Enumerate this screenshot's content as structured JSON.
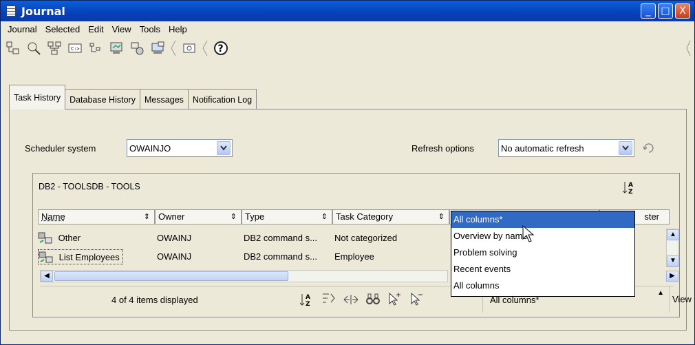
{
  "window": {
    "title": "Journal",
    "controls": [
      "_",
      "□",
      "X"
    ]
  },
  "menu": [
    "Journal",
    "Selected",
    "Edit",
    "View",
    "Tools",
    "Help"
  ],
  "toolbar": {
    "icons": [
      "task-center-icon",
      "control-center-icon",
      "replication-center-icon",
      "command-editor-icon",
      "satellite-admin-icon",
      "task-manager-icon",
      "health-center-icon",
      "configuration-assistant-icon",
      "tools-settings-icon",
      "help-icon"
    ]
  },
  "tabs": [
    {
      "label": "Task History",
      "active": true
    },
    {
      "label": "Database History",
      "active": false
    },
    {
      "label": "Messages",
      "active": false
    },
    {
      "label": "Notification Log",
      "active": false
    }
  ],
  "scheduler": {
    "label": "Scheduler system",
    "value": "OWAINJO"
  },
  "refresh": {
    "label": "Refresh options",
    "value": "No automatic refresh"
  },
  "grid": {
    "title": "DB2 - TOOLSDB - TOOLS",
    "columns": [
      "Name",
      "Owner",
      "Type",
      "Task Category",
      "",
      "ster"
    ],
    "rows": [
      {
        "name": "Other",
        "owner": "OWAINJ",
        "type": "DB2 command s...",
        "category": "Not categorized"
      },
      {
        "name": "List Employees",
        "owner": "OWAINJ",
        "type": "DB2 command s...",
        "category": "Employee"
      }
    ],
    "status": "4 of 4 items displayed",
    "view_select": "All columns*",
    "view_button": "View"
  },
  "view_dropdown": {
    "options": [
      "All columns*",
      "Overview by name",
      "Problem solving",
      "Recent events",
      "All columns"
    ],
    "selected_index": 0
  }
}
